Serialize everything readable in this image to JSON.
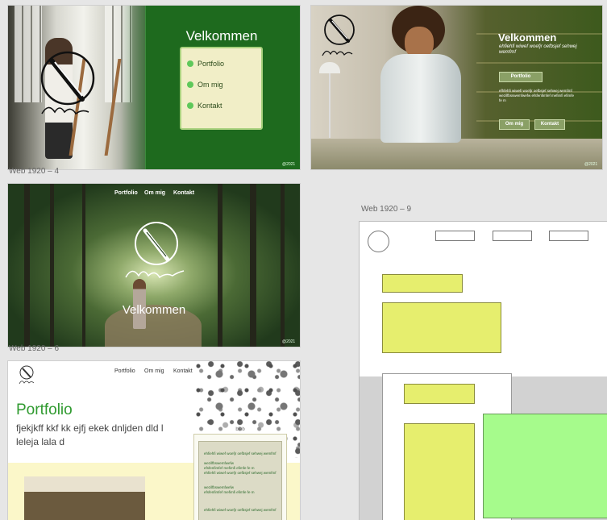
{
  "artboards": [
    {
      "name": "",
      "title": "Velkommen",
      "menu": [
        "Portfolio",
        "Om mig",
        "Kontakt"
      ],
      "copyright": "@2021"
    },
    {
      "name": "",
      "title": "Velkommen",
      "subtitle": "ehfiehfi wiwef woefjr oefbsjef sehwej wemfmf",
      "button": "Portfolio",
      "body": "efhfehfi wiwefi woefjr oefbsjef sehwej wemfmf wezilfbsswemfwefw efsfenfimfef mefimfi efimfe fe m",
      "buttons": [
        "Om mig",
        "Kontakt"
      ],
      "copyright": "@2021"
    },
    {
      "name": "Web 1920 – 4",
      "title": "Velkommen",
      "nav": [
        "Portfolio",
        "Om mig",
        "Kontakt"
      ],
      "copyright": "@2021"
    },
    {
      "name": "Web 1920 – 6",
      "title": "Portfolio",
      "lead": "fjekjkff kkf kk ejfj ekek dnljden dld l leleja lala d",
      "nav": [
        "Portfolio",
        "Om mig",
        "Kontakt"
      ],
      "panel_title": "bleb",
      "panel_lines": [
        "ehfiehfi wiwef woefjr oefbsjef sehwej wemfmf",
        "wezilfbswemfwefw",
        "efsfenfimfef mefimfi efimfe fe m",
        "ehfiehfi wiwef woefjr oefbsjef sehwej wemfmf",
        "wezilfbswemfwefw",
        "efsfenfimfef mefimfi efimfe fe m",
        "ehfiehfi wiwef woefjr oefbsjef sehwej wemfmf"
      ]
    },
    {
      "name": "Web 1920 – 9"
    }
  ],
  "colors": {
    "dark_green": "#1e6a1e",
    "menu_bg": "#f1eec7",
    "bullet": "#5fc85a",
    "portfolio_green": "#2f9a2f",
    "wire_yellow": "#e6ee6e",
    "wire_green": "#a6fb8c"
  },
  "logo": {
    "text": "AK Designs",
    "icon": "pen-circle-logo-icon"
  }
}
